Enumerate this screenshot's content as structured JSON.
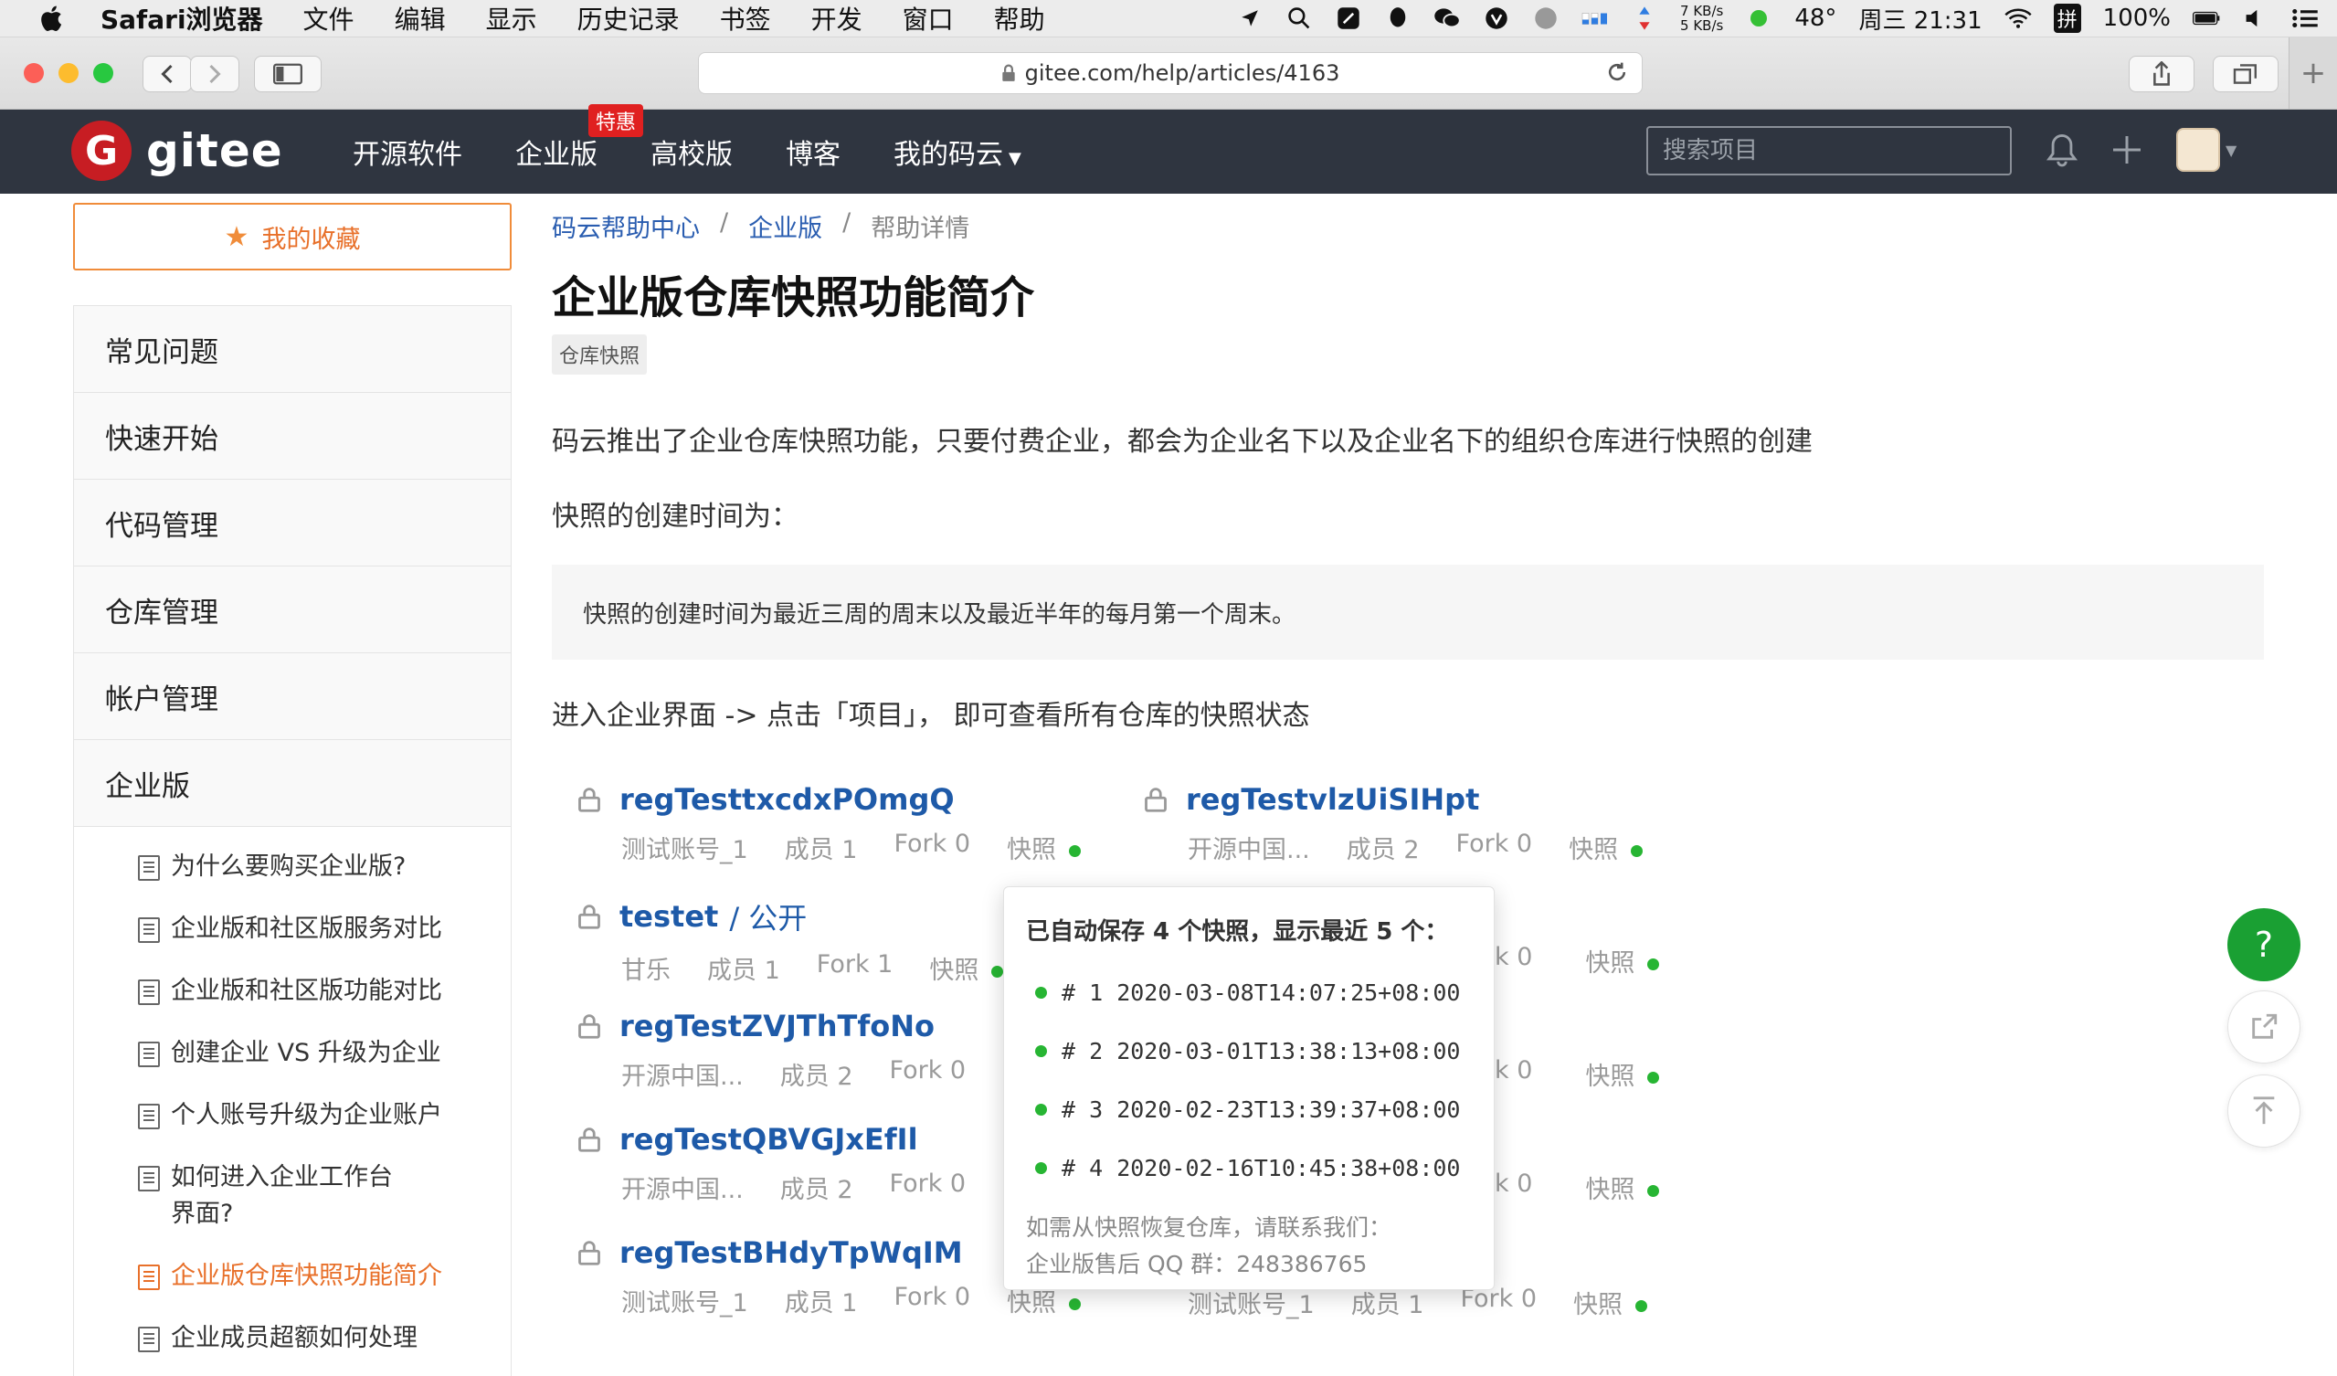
{
  "menubar": {
    "app": "Safari浏览器",
    "items": [
      "文件",
      "编辑",
      "显示",
      "历史记录",
      "书签",
      "开发",
      "窗口",
      "帮助"
    ],
    "net_up": "7 KB/s",
    "net_down": "5 KB/s",
    "temp": "48°",
    "clock": "周三 21:31",
    "input_method": "拼",
    "battery": "100%"
  },
  "safari": {
    "url": "gitee.com/help/articles/4163",
    "new_tab": "+"
  },
  "header": {
    "logo_letter": "G",
    "logo_text": "gitee",
    "nav": [
      "开源软件",
      "企业版",
      "高校版",
      "博客",
      "我的码云"
    ],
    "badge": "特惠",
    "search_placeholder": "搜索项目"
  },
  "sidebar": {
    "favorites": "我的收藏",
    "categories": [
      "常见问题",
      "快速开始",
      "代码管理",
      "仓库管理",
      "帐户管理",
      "企业版"
    ],
    "articles": [
      "为什么要购买企业版?",
      "企业版和社区版服务对比",
      "企业版和社区版功能对比",
      "创建企业 VS 升级为企业",
      "个人账号升级为企业账户",
      "如何进入企业工作台界面?",
      "企业版仓库快照功能简介",
      "企业成员超额如何处理"
    ]
  },
  "breadcrumb": {
    "home": "码云帮助中心",
    "section": "企业版",
    "current": "帮助详情",
    "sep": "/"
  },
  "article": {
    "title": "企业版仓库快照功能简介",
    "tag": "仓库快照",
    "p1": "码云推出了企业仓库快照功能，只要付费企业，都会为企业名下以及企业名下的组织仓库进行快照的创建",
    "p2": "快照的创建时间为：",
    "quote": "快照的创建时间为最近三周的周末以及最近半年的每月第一个周末。",
    "p3": "进入企业界面 -> 点击「项目」， 即可查看所有仓库的快照状态"
  },
  "repos_left": [
    {
      "name": "regTesttxcdxPOmgQ",
      "suffix": "",
      "owner": "测试账号_1",
      "members": "成员 1",
      "forks": "Fork 0",
      "snapshot": "快照"
    },
    {
      "name": "testet",
      "suffix": "/ 公开",
      "owner": "甘乐",
      "members": "成员 1",
      "forks": "Fork 1",
      "snapshot": "快照"
    },
    {
      "name": "regTestZVJThTfoNo",
      "suffix": "",
      "owner": "开源中国...",
      "members": "成员 2",
      "forks": "Fork 0",
      "snapshot": ""
    },
    {
      "name": "regTestQBVGJxEfIl",
      "suffix": "",
      "owner": "开源中国...",
      "members": "成员 2",
      "forks": "Fork 0",
      "snapshot": ""
    },
    {
      "name": "regTestBHdyTpWqIM",
      "suffix": "",
      "owner": "测试账号_1",
      "members": "成员 1",
      "forks": "Fork 0",
      "snapshot": "快照"
    }
  ],
  "repos_right": [
    {
      "name": "regTestvlzUiSIHpt",
      "owner": "开源中国...",
      "members": "成员 2",
      "forks": "Fork 0",
      "snapshot": "快照"
    },
    {
      "forks_partial": "k 0",
      "snapshot": "快照"
    },
    {
      "forks_partial": "k 0",
      "snapshot": "快照"
    },
    {
      "forks_partial": "k 0",
      "snapshot": "快照"
    },
    {
      "owner": "测试账号_1",
      "members": "成员 1",
      "forks": "Fork 0",
      "snapshot": "快照"
    }
  ],
  "popover": {
    "head": "已自动保存 4 个快照，显示最近 5 个：",
    "snapshots": [
      "# 1 2020-03-08T14:07:25+08:00",
      "# 2 2020-03-01T13:38:13+08:00",
      "# 3 2020-02-23T13:39:37+08:00",
      "# 4 2020-02-16T10:45:38+08:00"
    ],
    "foot1": "如需从快照恢复仓库，请联系我们：",
    "foot2": "企业版售后 QQ 群：248386765"
  },
  "fab": {
    "help": "?"
  },
  "colors": {
    "brand": "#c71d23",
    "header_bg": "#2f3540",
    "accent": "#e8702a",
    "link": "#1e5aa8",
    "snapshot_ok": "#27b533"
  }
}
